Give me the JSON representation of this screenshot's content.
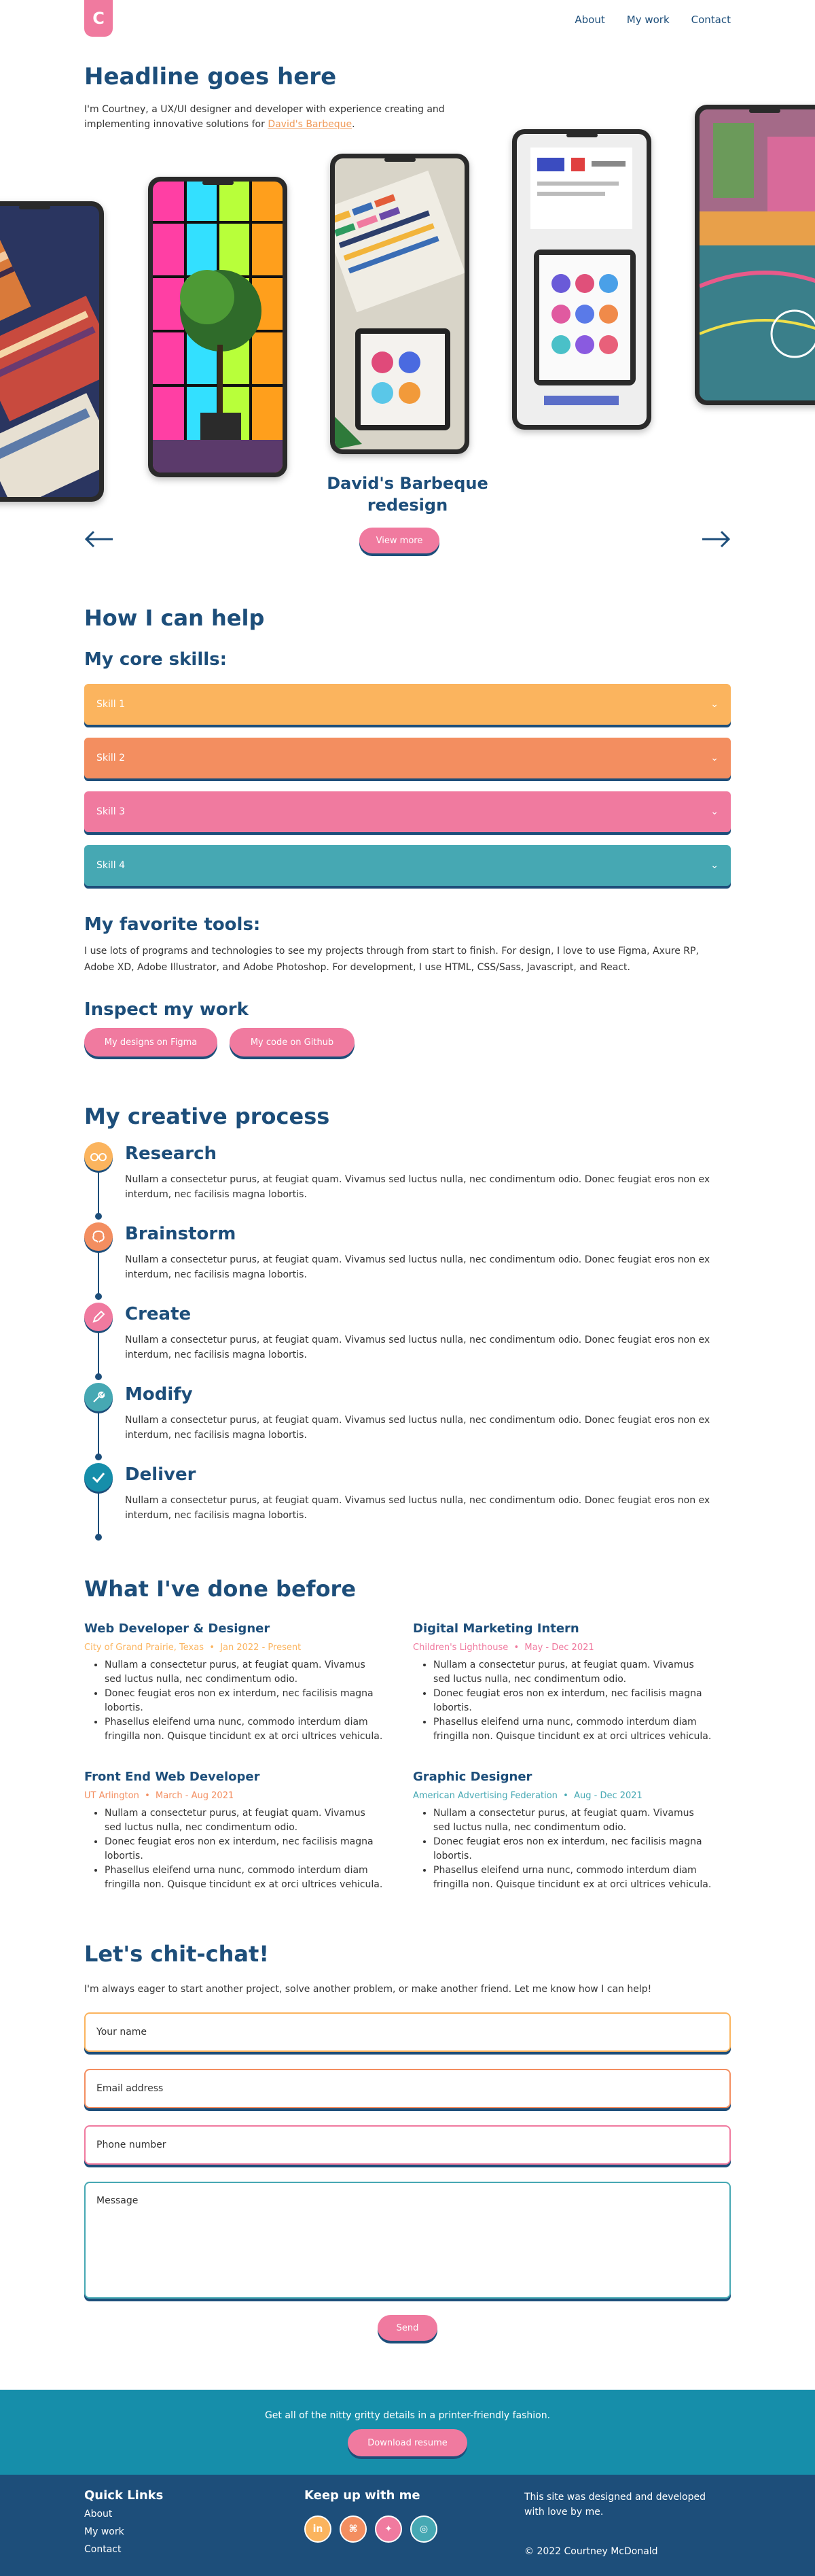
{
  "header": {
    "logo": "C",
    "nav": [
      "About",
      "My work",
      "Contact"
    ]
  },
  "hero": {
    "headline": "Headline goes here",
    "intro_prefix": "I'm Courtney, a UX/UI designer and developer with experience creating and implementing innovative solutions for ",
    "intro_link": "David's Barbeque",
    "intro_suffix": "."
  },
  "carousel": {
    "project_title": "David's Barbeque redesign",
    "view_more": "View more",
    "prev_icon": "arrow-left-icon",
    "next_icon": "arrow-right-icon"
  },
  "help": {
    "title": "How I can help",
    "skills_title": "My core skills:",
    "skills": [
      {
        "label": "Skill 1",
        "color": "#fbb45e"
      },
      {
        "label": "Skill 2",
        "color": "#f38e60"
      },
      {
        "label": "Skill 3",
        "color": "#f07a9f"
      },
      {
        "label": "Skill 4",
        "color": "#46a8b3"
      }
    ],
    "tools_title": "My favorite tools:",
    "tools_text": "I use lots of programs and technologies to see my projects through from start to finish. For design, I love to use Figma, Axure RP, Adobe XD, Adobe Illustrator, and Adobe Photoshop. For development, I use HTML, CSS/Sass, Javascript, and React.",
    "inspect_title": "Inspect my work",
    "figma_button": "My designs on Figma",
    "github_button": "My code on Github"
  },
  "process": {
    "title": "My creative process",
    "steps": [
      {
        "title": "Research",
        "icon": "glasses-icon",
        "color": "#fbb45e",
        "text": "Nullam a consectetur purus, at feugiat quam. Vivamus sed luctus nulla, nec condimentum odio. Donec feugiat eros non ex interdum, nec facilisis magna lobortis."
      },
      {
        "title": "Brainstorm",
        "icon": "brain-icon",
        "color": "#f38e60",
        "text": "Nullam a consectetur purus, at feugiat quam. Vivamus sed luctus nulla, nec condimentum odio. Donec feugiat eros non ex interdum, nec facilisis magna lobortis."
      },
      {
        "title": "Create",
        "icon": "pencil-icon",
        "color": "#f07a9f",
        "text": "Nullam a consectetur purus, at feugiat quam. Vivamus sed luctus nulla, nec condimentum odio. Donec feugiat eros non ex interdum, nec facilisis magna lobortis."
      },
      {
        "title": "Modify",
        "icon": "wrench-icon",
        "color": "#46a8b3",
        "text": "Nullam a consectetur purus, at feugiat quam. Vivamus sed luctus nulla, nec condimentum odio. Donec feugiat eros non ex interdum, nec facilisis magna lobortis."
      },
      {
        "title": "Deliver",
        "icon": "check-icon",
        "color": "#168eaa",
        "text": "Nullam a consectetur purus, at feugiat quam. Vivamus sed luctus nulla, nec condimentum odio. Donec feugiat eros non ex interdum, nec facilisis magna lobortis."
      }
    ]
  },
  "experience": {
    "title": "What I've done before",
    "jobs": [
      {
        "title": "Web Developer & Designer",
        "company": "City of Grand Prairie, Texas",
        "dates": "Jan 2022 - Present",
        "color": "#fbb45e",
        "bullets": [
          "Nullam a consectetur purus, at feugiat quam. Vivamus sed luctus nulla, nec condimentum odio.",
          "Donec feugiat eros non ex interdum, nec facilisis magna lobortis.",
          "Phasellus eleifend urna nunc, commodo interdum diam fringilla non. Quisque tincidunt ex at orci ultrices vehicula."
        ]
      },
      {
        "title": "Digital Marketing Intern",
        "company": "Children's Lighthouse",
        "dates": "May - Dec 2021",
        "color": "#f07a9f",
        "bullets": [
          "Nullam a consectetur purus, at feugiat quam. Vivamus sed luctus nulla, nec condimentum odio.",
          "Donec feugiat eros non ex interdum, nec facilisis magna lobortis.",
          "Phasellus eleifend urna nunc, commodo interdum diam fringilla non. Quisque tincidunt ex at orci ultrices vehicula."
        ]
      },
      {
        "title": "Front End Web Developer",
        "company": "UT Arlington",
        "dates": "March - Aug 2021",
        "color": "#f38e60",
        "bullets": [
          "Nullam a consectetur purus, at feugiat quam. Vivamus sed luctus nulla, nec condimentum odio.",
          "Donec feugiat eros non ex interdum, nec facilisis magna lobortis.",
          "Phasellus eleifend urna nunc, commodo interdum diam fringilla non. Quisque tincidunt ex at orci ultrices vehicula."
        ]
      },
      {
        "title": "Graphic Designer",
        "company": "American Advertising Federation",
        "dates": "Aug - Dec 2021",
        "color": "#46a8b3",
        "bullets": [
          "Nullam a consectetur purus, at feugiat quam. Vivamus sed luctus nulla, nec condimentum odio.",
          "Donec feugiat eros non ex interdum, nec facilisis magna lobortis.",
          "Phasellus eleifend urna nunc, commodo interdum diam fringilla non. Quisque tincidunt ex at orci ultrices vehicula."
        ]
      }
    ]
  },
  "contact": {
    "title": "Let's chit-chat!",
    "intro": "I'm always eager to start another project, solve another problem, or make another friend. Let me know how I can help!",
    "name_placeholder": "Your name",
    "email_placeholder": "Email address",
    "phone_placeholder": "Phone number",
    "message_placeholder": "Message",
    "send": "Send"
  },
  "banner": {
    "text": "Get all of the nitty gritty details in a printer-friendly fashion.",
    "button": "Download resume"
  },
  "footer": {
    "quick_links_title": "Quick Links",
    "links": [
      "About",
      "My work",
      "Contact"
    ],
    "social_title": "Keep up with me",
    "social": [
      {
        "icon": "linkedin-icon",
        "glyph": "in",
        "color": "#fbb45e"
      },
      {
        "icon": "github-icon",
        "glyph": "⌘",
        "color": "#f38e60"
      },
      {
        "icon": "figma-icon",
        "glyph": "✦",
        "color": "#f07a9f"
      },
      {
        "icon": "instagram-icon",
        "glyph": "◎",
        "color": "#46a8b3"
      }
    ],
    "credit": "This site was designed and developed with love by me.",
    "copyright": "© 2022 Courtney McDonald"
  }
}
